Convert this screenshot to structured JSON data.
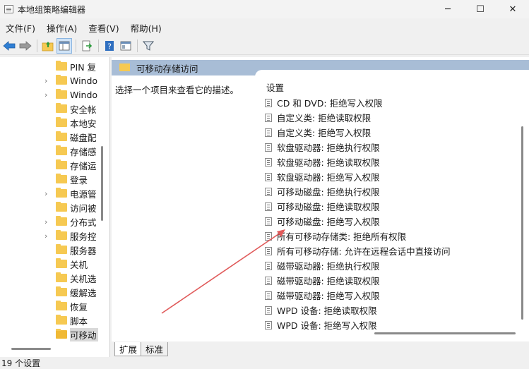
{
  "window": {
    "title": "本地组策略编辑器",
    "minimize": "─",
    "maximize": "☐",
    "close": "✕"
  },
  "menu": {
    "file": "文件(F)",
    "action": "操作(A)",
    "view": "查看(V)",
    "help": "帮助(H)"
  },
  "toolbar": {
    "icons": [
      "back-arrow-icon",
      "forward-arrow-icon",
      "up-folder-icon",
      "show-hide-tree-icon",
      "export-list-icon",
      "help-icon",
      "properties-view-icon",
      "filter-icon"
    ]
  },
  "tree": {
    "items": [
      {
        "label": "PIN 复",
        "expandable": false
      },
      {
        "label": "Windo",
        "expandable": true
      },
      {
        "label": "Windo",
        "expandable": true
      },
      {
        "label": "安全帐",
        "expandable": false
      },
      {
        "label": "本地安",
        "expandable": false
      },
      {
        "label": "磁盘配",
        "expandable": false
      },
      {
        "label": "存储感",
        "expandable": false
      },
      {
        "label": "存储运",
        "expandable": false
      },
      {
        "label": "登录",
        "expandable": false
      },
      {
        "label": "电源管",
        "expandable": true
      },
      {
        "label": "访问被",
        "expandable": false
      },
      {
        "label": "分布式",
        "expandable": true
      },
      {
        "label": "服务控",
        "expandable": true
      },
      {
        "label": "服务器",
        "expandable": false
      },
      {
        "label": "关机",
        "expandable": false
      },
      {
        "label": "关机选",
        "expandable": false
      },
      {
        "label": "缓解选",
        "expandable": false
      },
      {
        "label": "恢复",
        "expandable": false
      },
      {
        "label": "脚本",
        "expandable": false
      },
      {
        "label": "可移动",
        "expandable": false,
        "selected": true
      }
    ]
  },
  "right": {
    "header_title": "可移动存储访问",
    "description": "选择一个项目来查看它的描述。",
    "settings_header": "设置",
    "settings": [
      "CD 和 DVD: 拒绝写入权限",
      "自定义类: 拒绝读取权限",
      "自定义类: 拒绝写入权限",
      "软盘驱动器: 拒绝执行权限",
      "软盘驱动器: 拒绝读取权限",
      "软盘驱动器: 拒绝写入权限",
      "可移动磁盘: 拒绝执行权限",
      "可移动磁盘: 拒绝读取权限",
      "可移动磁盘: 拒绝写入权限",
      "所有可移动存储类: 拒绝所有权限",
      "所有可移动存储: 允许在远程会话中直接访问",
      "磁带驱动器: 拒绝执行权限",
      "磁带驱动器: 拒绝读取权限",
      "磁带驱动器: 拒绝写入权限",
      "WPD 设备: 拒绝读取权限",
      "WPD 设备: 拒绝写入权限"
    ],
    "tabs": [
      "扩展",
      "标准"
    ]
  },
  "status": {
    "text": "19 个设置"
  },
  "colors": {
    "header_bg": "#a8bdd6",
    "folder": "#f6c952",
    "annotation_arrow": "#e05a5a"
  }
}
